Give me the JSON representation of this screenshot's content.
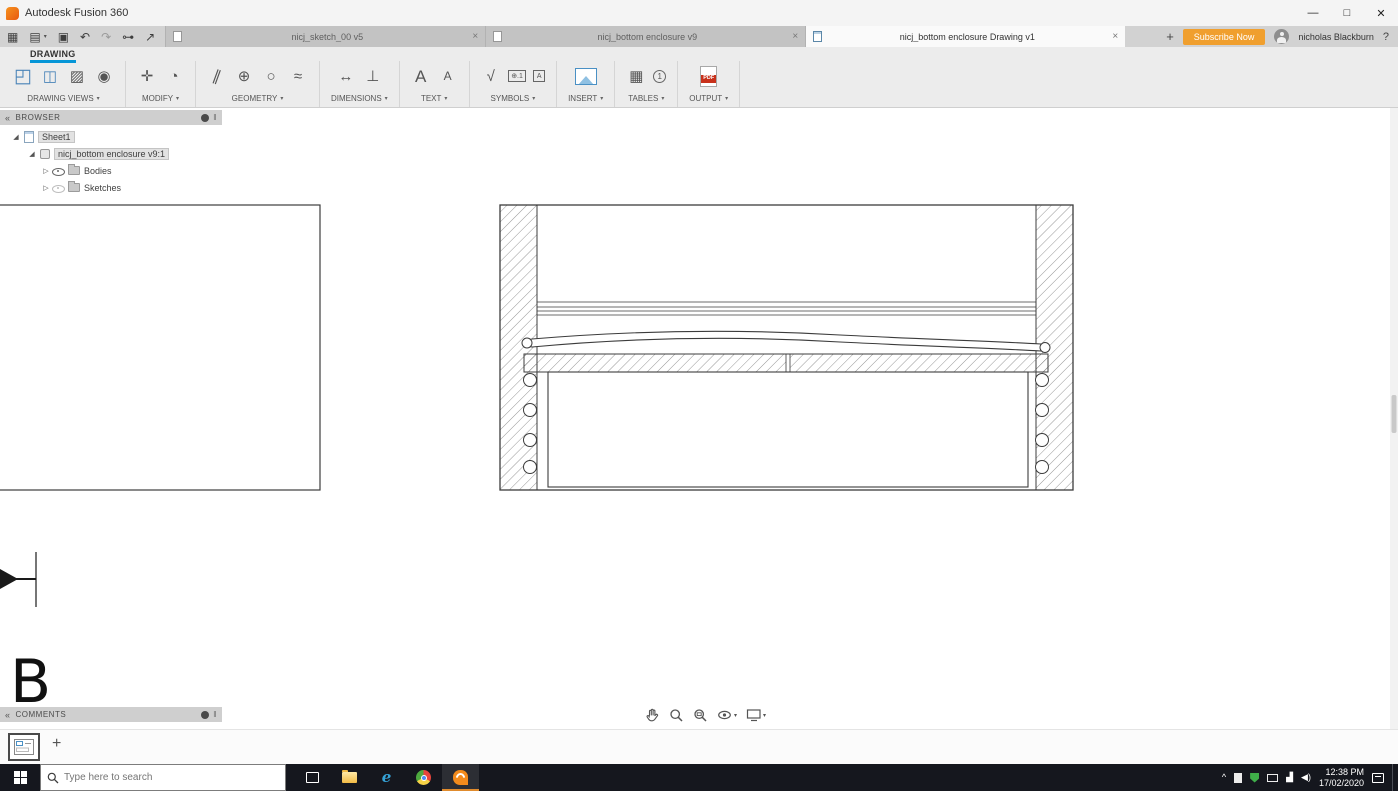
{
  "window": {
    "title": "Autodesk Fusion 360"
  },
  "tabs": {
    "items": [
      {
        "label": "nicj_sketch_00 v5",
        "active": false
      },
      {
        "label": "nicj_bottom enclosure v9",
        "active": false
      },
      {
        "label": "nicj_bottom enclosure Drawing v1",
        "active": true
      }
    ],
    "subscribe_label": "Subscribe Now",
    "username": "nicholas Blackburn",
    "help_label": "?"
  },
  "ribbon": {
    "workspace_label": "DRAWING",
    "groups": [
      {
        "label": "DRAWING VIEWS"
      },
      {
        "label": "MODIFY"
      },
      {
        "label": "GEOMETRY"
      },
      {
        "label": "DIMENSIONS"
      },
      {
        "label": "TEXT"
      },
      {
        "label": "SYMBOLS"
      },
      {
        "label": "INSERT"
      },
      {
        "label": "TABLES"
      },
      {
        "label": "OUTPUT"
      }
    ]
  },
  "browser": {
    "title": "BROWSER",
    "items": [
      {
        "label": "Sheet1"
      },
      {
        "label": "nicj_bottom enclosure v9:1"
      },
      {
        "label": "Bodies"
      },
      {
        "label": "Sketches"
      }
    ]
  },
  "comments": {
    "title": "COMMENTS"
  },
  "drawing": {
    "section_label": "B"
  },
  "taskbar": {
    "search_placeholder": "Type here to search",
    "time": "12:38 PM",
    "date": "17/02/2020"
  },
  "colors": {
    "accent_blue": "#0696d7",
    "subscribe_orange": "#f09f2e",
    "fusion_orange": "#f38b1c",
    "pdf_red": "#c8311b",
    "taskbar_dark": "#15171e"
  },
  "icons": {
    "minimize": "—",
    "maximize": "□",
    "close": "✕",
    "close_tab": "×",
    "add_tab": "+",
    "add_sheet": "+",
    "caret": "▾",
    "collapse_panel": "«",
    "grip": "‖",
    "grid_menu": "▦",
    "file_menu": "▤",
    "save": "▣",
    "undo": "↶",
    "redo": "↷",
    "link": "⊶",
    "share": "↗",
    "base_view": "◰",
    "projected_view": "◫",
    "section_view": "▨",
    "detail_view": "◉",
    "move": "✛",
    "rotate": "◔",
    "line": "∥",
    "center_mark": "⊕",
    "circle": "○",
    "spline": "≈",
    "dimension": "↔",
    "ordinate": "⊥",
    "text": "A",
    "leader_text": "A",
    "surface_finish": "√",
    "fcf": "⊕.1",
    "datum": "A",
    "table": "▦",
    "balloon": "1",
    "pdf": "PDF",
    "expanded": "◢",
    "collapsed": "▷",
    "tray_expand": "^",
    "signal": "▟",
    "speaker": "◀)",
    "ie": "e"
  }
}
